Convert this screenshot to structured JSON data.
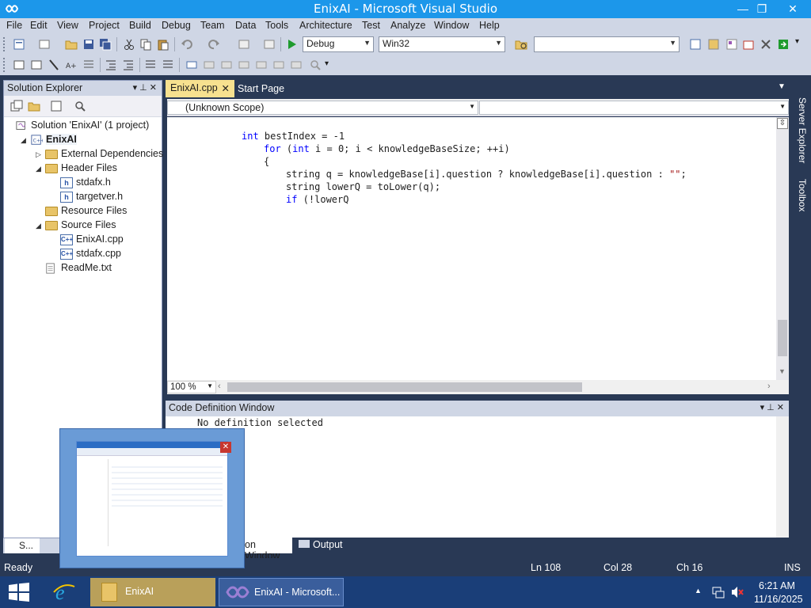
{
  "window": {
    "title": "EnixAI - Microsoft Visual Studio",
    "minimize_glyph": "—",
    "restore_glyph": "❐",
    "close_glyph": "✕"
  },
  "menu": [
    "File",
    "Edit",
    "View",
    "Project",
    "Build",
    "Debug",
    "Team",
    "Data",
    "Tools",
    "Architecture",
    "Test",
    "Analyze",
    "Window",
    "Help"
  ],
  "toolbar": {
    "config": "Debug",
    "platform": "Win32",
    "search_value": ""
  },
  "solution_explorer": {
    "title": "Solution Explorer",
    "pin_glyph": "▾ ⊥ ✕",
    "tree": [
      {
        "label": "Solution 'EnixAI' (1 project)",
        "icon": "solution-icon",
        "indent": 0,
        "expander": ""
      },
      {
        "label": "EnixAI",
        "icon": "project-icon",
        "indent": 1,
        "expander": "◢",
        "bold": true
      },
      {
        "label": "External Dependencies",
        "icon": "folder-icon",
        "indent": 2,
        "expander": "▷"
      },
      {
        "label": "Header Files",
        "icon": "folder-icon",
        "indent": 2,
        "expander": "◢"
      },
      {
        "label": "stdafx.h",
        "icon": "header-file-icon",
        "indent": 3,
        "expander": ""
      },
      {
        "label": "targetver.h",
        "icon": "header-file-icon",
        "indent": 3,
        "expander": ""
      },
      {
        "label": "Resource Files",
        "icon": "folder-icon",
        "indent": 2,
        "expander": ""
      },
      {
        "label": "Source Files",
        "icon": "folder-icon",
        "indent": 2,
        "expander": "◢"
      },
      {
        "label": "EnixAI.cpp",
        "icon": "cpp-file-icon",
        "indent": 3,
        "expander": ""
      },
      {
        "label": "stdafx.cpp",
        "icon": "cpp-file-icon",
        "indent": 3,
        "expander": ""
      },
      {
        "label": "ReadMe.txt",
        "icon": "text-file-icon",
        "indent": 2,
        "expander": ""
      }
    ],
    "bottom_tab": "S..."
  },
  "editor": {
    "tabs": [
      {
        "label": "EnixAI.cpp",
        "active": true
      },
      {
        "label": "Start Page",
        "active": false
      }
    ],
    "scope": "(Unknown Scope)",
    "zoom": "100 %",
    "code": [
      [
        {
          "t": "int",
          "k": "kw"
        },
        {
          "t": " bestIndex = -1",
          "k": ""
        }
      ],
      [
        {
          "t": "for",
          "k": "kw"
        },
        {
          "t": " (",
          "k": ""
        },
        {
          "t": "int",
          "k": "kw"
        },
        {
          "t": " i = 0; i < knowledgeBaseSize; ++i)",
          "k": ""
        }
      ],
      [
        {
          "t": "{",
          "k": ""
        }
      ],
      [
        {
          "t": "string q = knowledgeBase[i].question ? knowledgeBase[i].question : ",
          "k": ""
        },
        {
          "t": "\"\"",
          "k": "str"
        },
        {
          "t": ";",
          "k": ""
        }
      ],
      [
        {
          "t": "string lowerQ = toLower(q);",
          "k": ""
        }
      ],
      [
        {
          "t": "if",
          "k": "kw"
        },
        {
          "t": " (!lowerQ",
          "k": ""
        }
      ]
    ]
  },
  "code_definition": {
    "title": "Code Definition Window",
    "text": "No definition selected",
    "tabs": [
      "on Window",
      "Output"
    ]
  },
  "side_tabs": [
    "Server Explorer",
    "Toolbox"
  ],
  "status": {
    "ready": "Ready",
    "ln": "Ln 108",
    "col": "Col 28",
    "ch": "Ch 16",
    "ins": "INS"
  },
  "taskbar": {
    "items": [
      {
        "label": "EnixAI",
        "icon": "folder-icon"
      },
      {
        "label": "EnixAI - Microsoft...",
        "icon": "visual-studio-icon"
      }
    ],
    "time": "6:21 AM",
    "date": "11/16/2025"
  },
  "colors": {
    "accent": "#1c97ea",
    "chrome": "#293955",
    "active_tab": "#f7e18f",
    "menu_bg": "#cfd6e5"
  }
}
